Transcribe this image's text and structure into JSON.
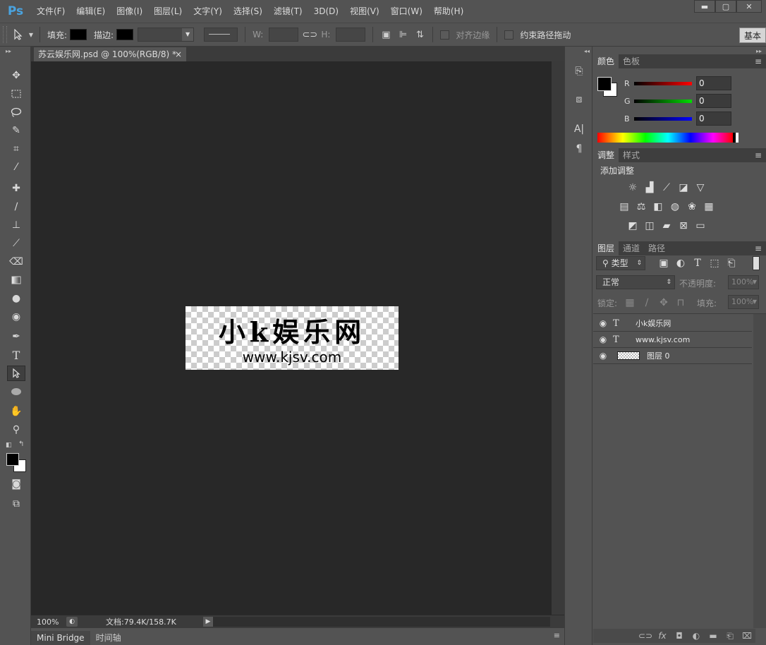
{
  "app": {
    "logo": "Ps"
  },
  "menu": [
    "文件(F)",
    "编辑(E)",
    "图像(I)",
    "图层(L)",
    "文字(Y)",
    "选择(S)",
    "滤镜(T)",
    "3D(D)",
    "视图(V)",
    "窗口(W)",
    "帮助(H)"
  ],
  "window_controls": {
    "minimize": "▬",
    "maximize": "▢",
    "close": "✕"
  },
  "options": {
    "fill_label": "填充:",
    "stroke_label": "描边:",
    "w_label": "W:",
    "h_label": "H:",
    "align_edges_label": "对齐边缘",
    "constrain_path_label": "约束路径拖动",
    "workspace_label": "基本"
  },
  "document": {
    "tab_title": "苏云娱乐网.psd @ 100%(RGB/8) *",
    "tab_close": "×",
    "image_title": "小k娱乐网",
    "image_url": "www.kjsv.com",
    "zoom": "100%",
    "doc_info": "文档:79.4K/158.7K"
  },
  "bottom_tabs": [
    "Mini Bridge",
    "时间轴"
  ],
  "color_panel": {
    "tabs": [
      "颜色",
      "色板"
    ],
    "channels": [
      {
        "letter": "R",
        "value": "0",
        "color": "#ff0000"
      },
      {
        "letter": "G",
        "value": "0",
        "color": "#00c000"
      },
      {
        "letter": "B",
        "value": "0",
        "color": "#0000ff"
      }
    ]
  },
  "adjust_panel": {
    "tabs": [
      "调整",
      "样式"
    ],
    "title": "添加调整"
  },
  "layers_panel": {
    "tabs": [
      "图层",
      "通道",
      "路径"
    ],
    "filter_label": "类型",
    "blend_mode": "正常",
    "opacity_label": "不透明度:",
    "opacity_value": "100%",
    "lock_label": "锁定:",
    "fill_label": "填充:",
    "fill_value": "100%",
    "layers": [
      {
        "type": "T",
        "name": "小k娱乐网"
      },
      {
        "type": "T",
        "name": "www.kjsv.com"
      },
      {
        "type": "img",
        "name": "图层 0"
      }
    ]
  },
  "colors": {
    "accent": "#4aa3df",
    "canvas_bg": "#282828",
    "ui_bg": "#535353"
  }
}
